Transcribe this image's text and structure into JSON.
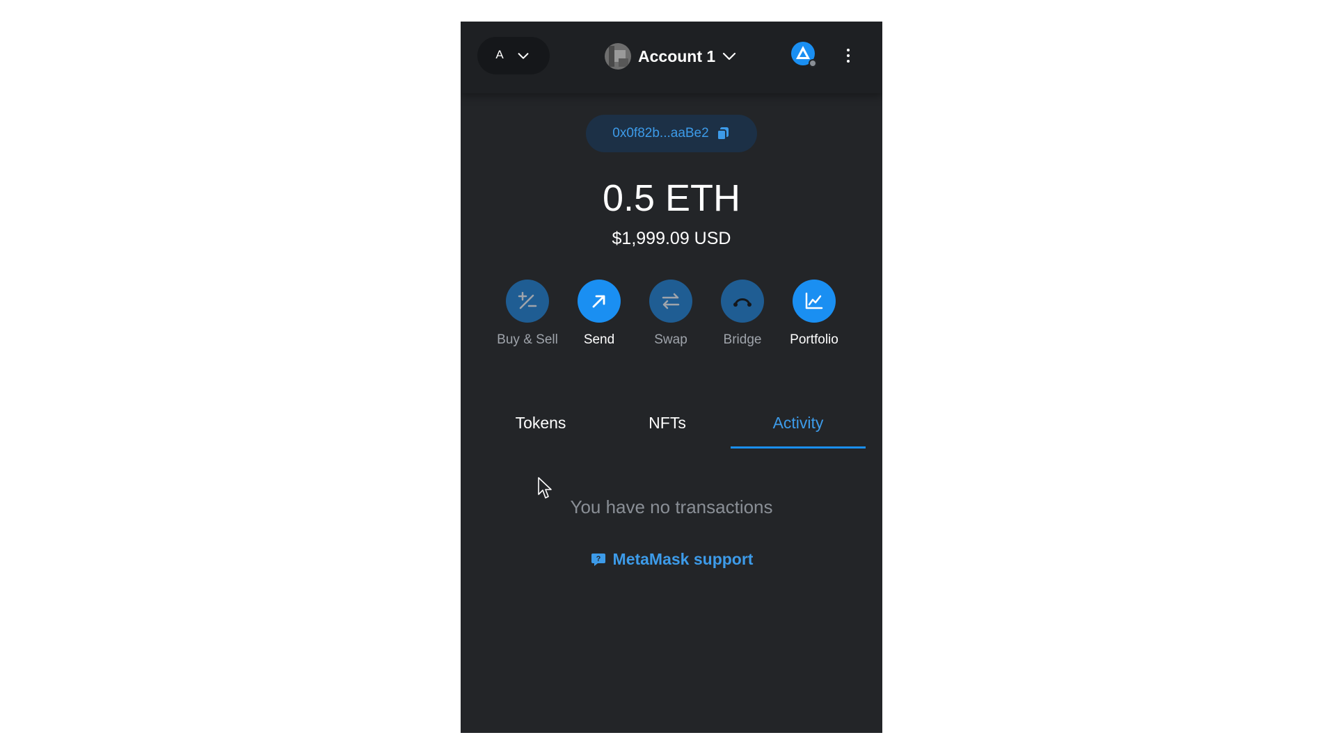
{
  "header": {
    "network_initial": "A",
    "account_name": "Account 1"
  },
  "wallet": {
    "address": "0x0f82b...aaBe2",
    "balance": "0.5 ETH",
    "fiat_balance": "$1,999.09 USD"
  },
  "actions": [
    {
      "label": "Buy & Sell",
      "icon": "plus-minus-icon",
      "state": "disabled"
    },
    {
      "label": "Send",
      "icon": "arrow-up-right-icon",
      "state": "enabled"
    },
    {
      "label": "Swap",
      "icon": "swap-arrows-icon",
      "state": "disabled"
    },
    {
      "label": "Bridge",
      "icon": "bridge-icon",
      "state": "disabled"
    },
    {
      "label": "Portfolio",
      "icon": "chart-icon",
      "state": "enabled"
    }
  ],
  "tabs": [
    {
      "label": "Tokens",
      "selected": false
    },
    {
      "label": "NFTs",
      "selected": false
    },
    {
      "label": "Activity",
      "selected": true
    }
  ],
  "activity": {
    "empty_message": "You have no transactions",
    "support_label": "MetaMask support"
  },
  "colors": {
    "background": "#232528",
    "accent": "#1a8ff2",
    "link": "#3d9be9",
    "muted_button": "#1f5d93"
  }
}
